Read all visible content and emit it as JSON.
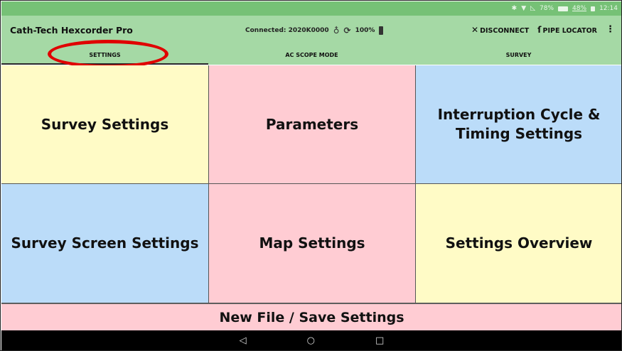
{
  "status_bar": {
    "icons": [
      "bluetooth-icon",
      "wifi-icon",
      "signal-icon",
      "battery-icon"
    ],
    "battery_a": "78%",
    "battery_b": "48%",
    "time": "12:14"
  },
  "header": {
    "title": "Cath-Tech Hexcorder Pro",
    "connection": "Connected: 2020K0000",
    "battery": "100%",
    "disconnect_label": "DISCONNECT",
    "pipe_locator_label": "PIPE LOCATOR"
  },
  "tabs": [
    {
      "label": "SETTINGS",
      "active": true
    },
    {
      "label": "AC SCOPE MODE",
      "active": false
    },
    {
      "label": "SURVEY",
      "active": false
    }
  ],
  "tiles": [
    {
      "label": "Survey Settings",
      "color": "#fffbc6"
    },
    {
      "label": "Parameters",
      "color": "#ffccd3"
    },
    {
      "label": "Interruption Cycle & Timing Settings",
      "color": "#bbdcf9"
    },
    {
      "label": "Survey Screen Settings",
      "color": "#bbdcf9"
    },
    {
      "label": "Map Settings",
      "color": "#ffccd3"
    },
    {
      "label": "Settings Overview",
      "color": "#fffbc6"
    }
  ],
  "bottom_button": {
    "label": "New File / Save Settings"
  },
  "colors": {
    "statusbar": "#76c176",
    "appbar": "#a5d9a5",
    "annotation": "#e00000"
  }
}
